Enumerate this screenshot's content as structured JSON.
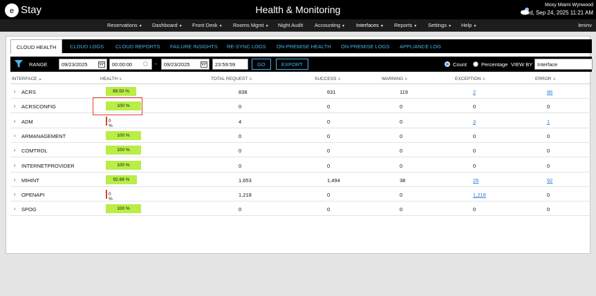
{
  "header": {
    "logo_text": "Stay",
    "title": "Health & Monitoring",
    "property": "Moxy Miami Wynwood",
    "datetime": "Wed, Sep 24, 2025 11:21 AM"
  },
  "nav": {
    "items": [
      "Reservations",
      "Dashboard",
      "Front Desk",
      "Rooms Mgmt",
      "Night Audit",
      "Accounting",
      "Interfaces",
      "Reports",
      "Settings",
      "Help"
    ],
    "user": "leninv"
  },
  "tabs": [
    "CLOUD HEALTH",
    "CLOUD LOGS",
    "CLOUD REPORTS",
    "FAILURE INSIGHTS",
    "RE-SYNC LOGS",
    "ON-PREMISE HEALTH",
    "ON-PREMISE LOGS",
    "APPLIANCE LOG"
  ],
  "filter": {
    "range_label": "RANGE",
    "start_date": "09/23/2025",
    "start_time": "00:00:00",
    "dash": "-",
    "end_date": "09/23/2025",
    "end_time": "23:59:59",
    "go_label": "GO",
    "export_label": "EXPORT",
    "count_label": "Count",
    "percentage_label": "Percentage",
    "view_by_label": "VIEW BY",
    "view_by_value": "Interface",
    "selected_mode": "Count"
  },
  "table": {
    "headers": [
      "INTERFACE",
      "HEALTH",
      "TOTAL REQUEST",
      "SUCCESS",
      "WARNING",
      "EXCEPTION",
      "ERROR"
    ],
    "rows": [
      {
        "interface": "ACRS",
        "health_label": "89.50 %",
        "health": 89.5,
        "total": "838",
        "success": "631",
        "warning": "119",
        "exception": "2",
        "error": "86"
      },
      {
        "interface": "ACRSCONFIG",
        "health_label": "100 %",
        "health": 100,
        "total": "0",
        "success": "0",
        "warning": "0",
        "exception": "0",
        "error": "0"
      },
      {
        "interface": "ADM",
        "health_label": "0 %",
        "health": 0,
        "total": "4",
        "success": "0",
        "warning": "0",
        "exception": "3",
        "error": "1"
      },
      {
        "interface": "ARMANAGEMENT",
        "health_label": "100 %",
        "health": 100,
        "total": "0",
        "success": "0",
        "warning": "0",
        "exception": "0",
        "error": "0"
      },
      {
        "interface": "COMTROL",
        "health_label": "100 %",
        "health": 100,
        "total": "0",
        "success": "0",
        "warning": "0",
        "exception": "0",
        "error": "0"
      },
      {
        "interface": "INTERNETPROVIDER",
        "health_label": "100 %",
        "health": 100,
        "total": "0",
        "success": "0",
        "warning": "0",
        "exception": "0",
        "error": "0"
      },
      {
        "interface": "MIHINT",
        "health_label": "92.68 %",
        "health": 92.68,
        "total": "1,653",
        "success": "1,494",
        "warning": "38",
        "exception": "29",
        "error": "92"
      },
      {
        "interface": "OPENAPI",
        "health_label": "0 %",
        "health": 0,
        "total": "1,218",
        "success": "0",
        "warning": "0",
        "exception": "1,218",
        "error": "0"
      },
      {
        "interface": "SPOG",
        "health_label": "100 %",
        "health": 100,
        "total": "0",
        "success": "0",
        "warning": "0",
        "exception": "0",
        "error": "0"
      }
    ]
  },
  "colors": {
    "accent": "#47b3e8",
    "health_good": "#b8ee46",
    "health_bad": "#e53b2c",
    "link": "#2a7fd4"
  }
}
